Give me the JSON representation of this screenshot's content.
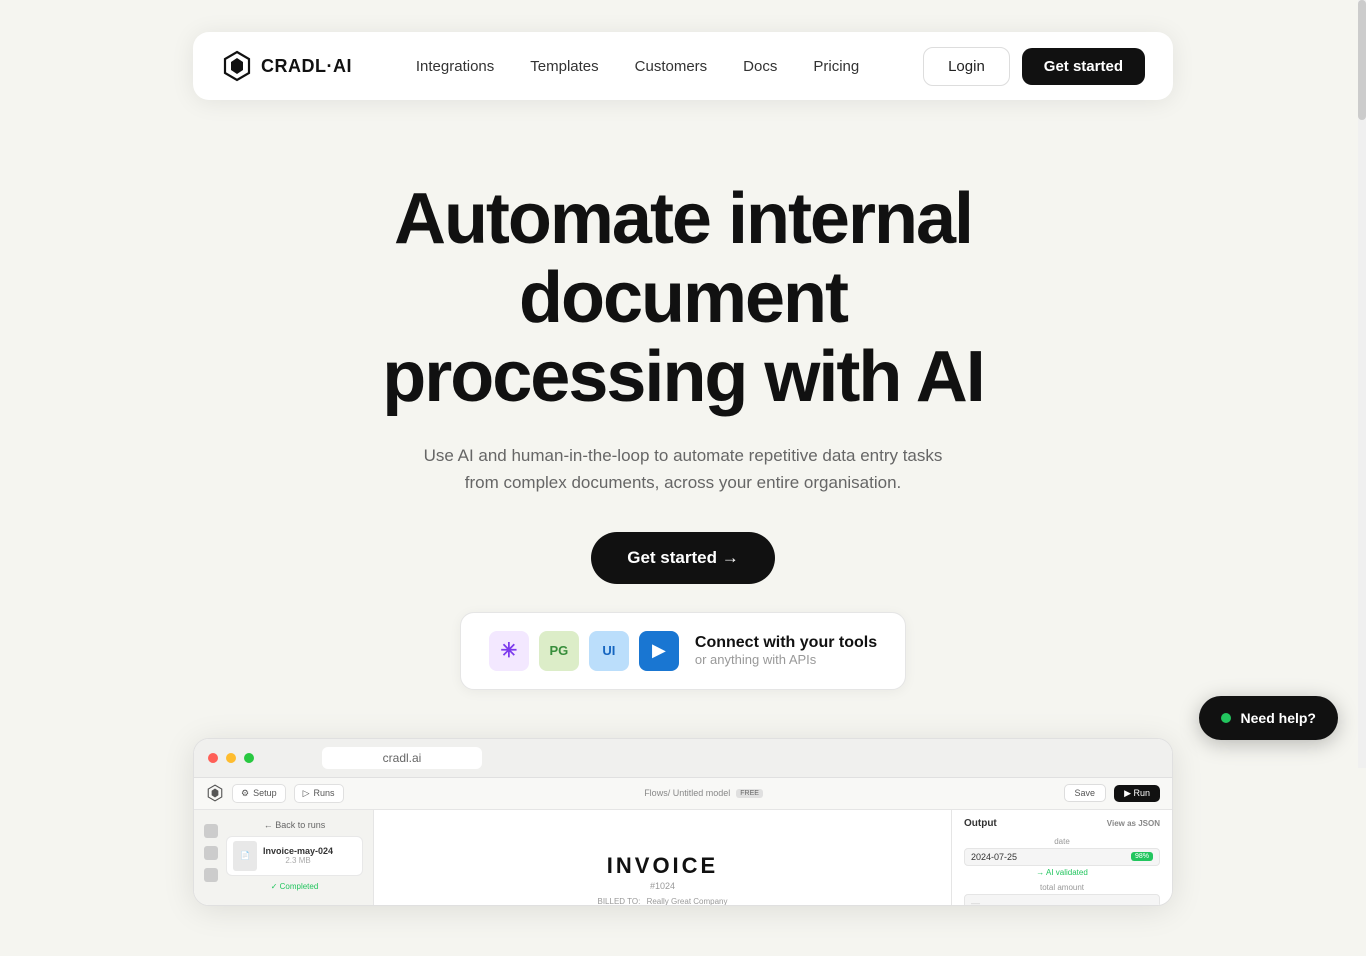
{
  "meta": {
    "title": "Cradl AI - Automate internal document processing with AI"
  },
  "nav": {
    "logo_text": "CRADL·AI",
    "links": [
      {
        "id": "integrations",
        "label": "Integrations"
      },
      {
        "id": "templates",
        "label": "Templates"
      },
      {
        "id": "customers",
        "label": "Customers"
      },
      {
        "id": "docs",
        "label": "Docs"
      },
      {
        "id": "pricing",
        "label": "Pricing"
      }
    ],
    "login_label": "Login",
    "get_started_label": "Get started"
  },
  "hero": {
    "title_line1": "Automate internal document",
    "title_line2": "processing with AI",
    "subtitle": "Use AI and human-in-the-loop to automate repetitive data entry tasks from complex documents, across your entire organisation.",
    "cta_label": "Get started →"
  },
  "integration_banner": {
    "title": "Connect with your tools",
    "subtitle": "or anything with APIs",
    "icons": [
      {
        "id": "anthropic",
        "symbol": "✳",
        "bg": "#f3e8ff",
        "color": "#7c3aed"
      },
      {
        "id": "pg",
        "symbol": "PG",
        "bg": "#e8f5e9",
        "color": "#2e7d32"
      },
      {
        "id": "ui",
        "symbol": "UI",
        "bg": "#e3f2fd",
        "color": "#1565c0"
      },
      {
        "id": "make",
        "symbol": "▶",
        "bg": "#e3f2fd",
        "color": "#1976d2"
      }
    ]
  },
  "screenshot": {
    "url": "cradl.ai",
    "topbar": {
      "setup_label": "Setup",
      "runs_label": "Runs",
      "flows_label": "Flows/ Untitled model",
      "free_badge": "FREE",
      "save_label": "Save",
      "run_label": "▶ Run"
    },
    "sidebar": {
      "back_label": "← Back to runs",
      "file_name": "Invoice-may-024",
      "file_size": "2.3 MB",
      "status_label": "✓ Completed"
    },
    "invoice": {
      "title": "INVOICE",
      "number": "#1024",
      "billed_to_label": "BILLED TO:",
      "company_name": "Really Great Company"
    },
    "output": {
      "header": "Output",
      "view_json": "View as JSON",
      "fields": [
        {
          "label": "date",
          "value": "2024-07-25",
          "confidence": "98%",
          "ai_validated": true
        },
        {
          "label": "total amount",
          "value": "",
          "confidence": "",
          "ai_validated": false
        }
      ]
    }
  },
  "chat_widget": {
    "label": "Need help?"
  }
}
